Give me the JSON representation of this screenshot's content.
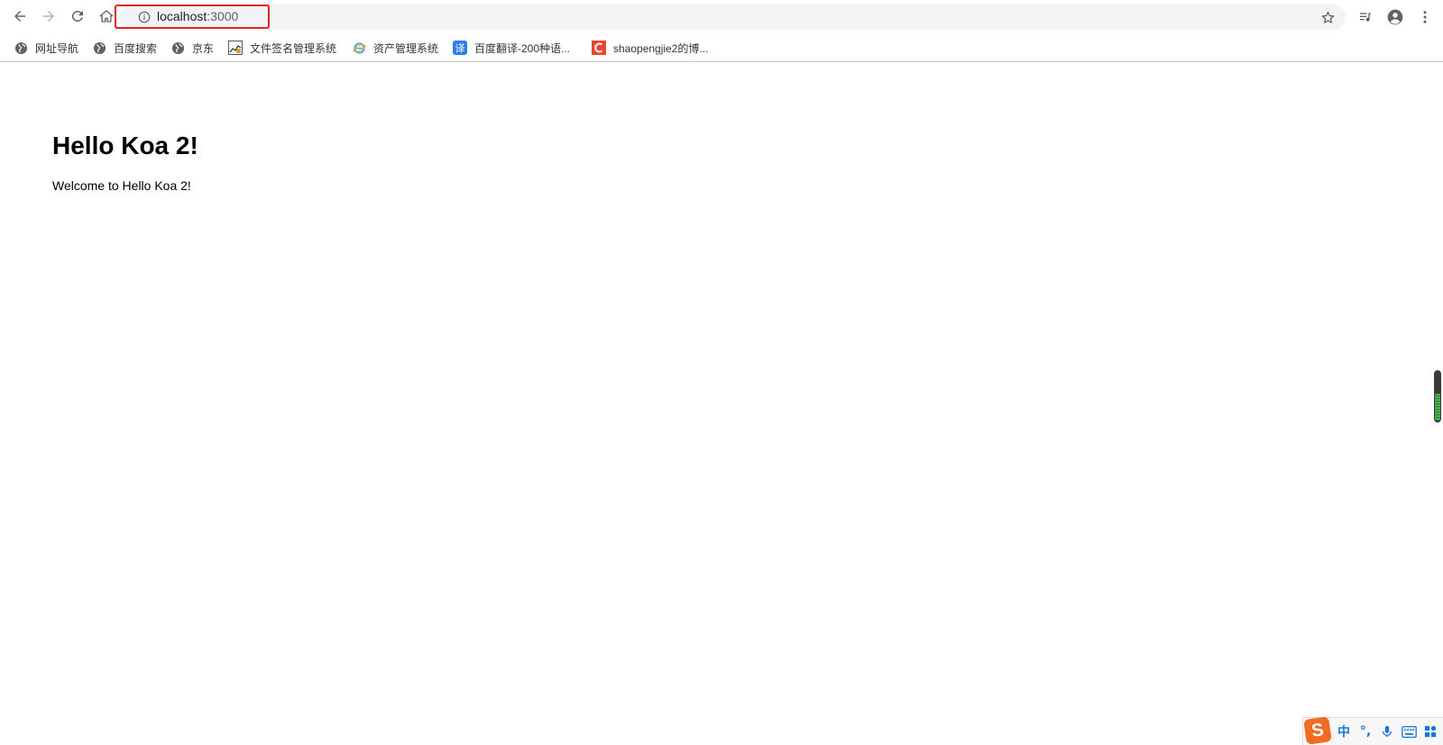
{
  "browser": {
    "address": {
      "host": "localhost",
      "port": ":3000"
    },
    "bookmarks": [
      {
        "label": "网址导航",
        "icon": "globe-icon"
      },
      {
        "label": "百度搜索",
        "icon": "globe-icon"
      },
      {
        "label": "京东",
        "icon": "globe-icon"
      },
      {
        "label": "文件签名管理系统",
        "icon": "chart-icon"
      },
      {
        "label": "资产管理系统",
        "icon": "ie-icon"
      },
      {
        "label": "百度翻译-200种语...",
        "icon": "translate-icon"
      },
      {
        "label": "shaopengjie2的博...",
        "icon": "csdn-icon"
      }
    ]
  },
  "page": {
    "title": "Hello Koa 2!",
    "text": "Welcome to Hello Koa 2!"
  },
  "ime": {
    "logo": "S",
    "mode": "中",
    "punct": "°,"
  },
  "colors": {
    "highlight": "#e0261d",
    "ime_accent": "#1677d6",
    "ime_logo": "#f36a22"
  }
}
